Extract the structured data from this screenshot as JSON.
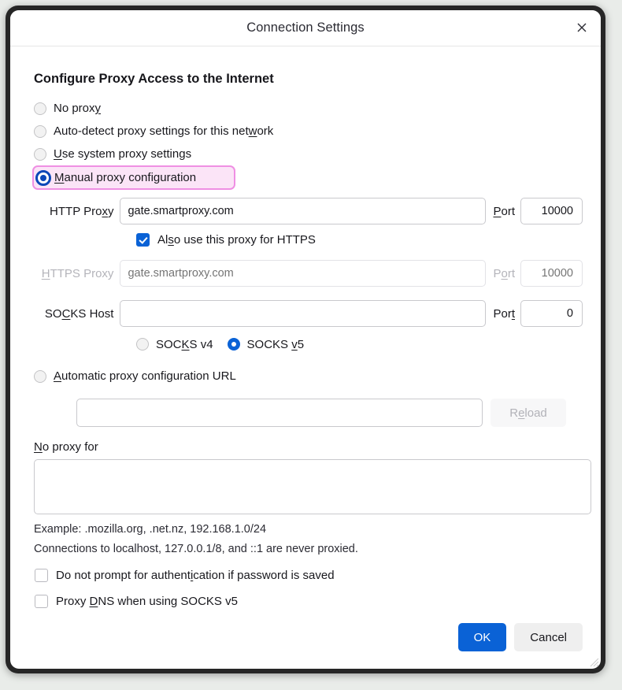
{
  "window": {
    "title": "Connection Settings",
    "close_icon": "close-icon"
  },
  "heading": "Configure Proxy Access to the Internet",
  "proxy_mode": {
    "selected": "manual",
    "options": [
      {
        "id": "none",
        "label": "No proxy",
        "accel": "y",
        "selected": false
      },
      {
        "id": "auto",
        "label": "Auto-detect proxy settings for this network",
        "accel": "w",
        "selected": false
      },
      {
        "id": "system",
        "label": "Use system proxy settings",
        "accel": "U",
        "selected": false
      },
      {
        "id": "manual",
        "label": "Manual proxy configuration",
        "accel": "M",
        "selected": true,
        "highlighted": true
      }
    ]
  },
  "manual": {
    "http": {
      "label": "HTTP Proxy",
      "label_accel": "x",
      "value": "gate.smartproxy.com",
      "placeholder": "",
      "port_label": "Port",
      "port_accel": "P",
      "port_value": "10000",
      "disabled": false
    },
    "also_https": {
      "label": "Also use this proxy for HTTPS",
      "accel": "s",
      "checked": true
    },
    "https": {
      "label": "HTTPS Proxy",
      "label_accel": "H",
      "value": "",
      "placeholder": "gate.smartproxy.com",
      "port_label": "Port",
      "port_accel": "o",
      "port_value": "",
      "port_placeholder": "10000",
      "disabled": true
    },
    "socks": {
      "label": "SOCKS Host",
      "label_accel": "C",
      "value": "",
      "placeholder": "",
      "port_label": "Port",
      "port_accel": "t",
      "port_value": "0",
      "disabled": false,
      "versions": [
        {
          "id": "v4",
          "label": "SOCKS v4",
          "accel": "K",
          "selected": false
        },
        {
          "id": "v5",
          "label": "SOCKS v5",
          "accel": "v",
          "selected": true
        }
      ]
    }
  },
  "pac": {
    "label": "Automatic proxy configuration URL",
    "accel": "A",
    "selected": false,
    "url_value": "",
    "url_placeholder": "",
    "reload_label": "Reload",
    "reload_accel": "e",
    "reload_disabled": true
  },
  "no_proxy": {
    "label": "No proxy for",
    "accel": "N",
    "value": "",
    "placeholder": ""
  },
  "hints": [
    "Example: .mozilla.org, .net.nz, 192.168.1.0/24",
    "Connections to localhost, 127.0.0.1/8, and ::1 are never proxied."
  ],
  "bottom_checks": [
    {
      "id": "no-auth-prompt",
      "label": "Do not prompt for authentication if password is saved",
      "accel": "i",
      "checked": false
    },
    {
      "id": "proxy-dns",
      "label": "Proxy DNS when using SOCKS v5",
      "accel": "D",
      "checked": false
    }
  ],
  "footer": {
    "ok_label": "OK",
    "cancel_label": "Cancel"
  },
  "colors": {
    "accent": "#0a62d6",
    "highlight_fill": "#fbe4f7",
    "highlight_border": "#ef8fe3",
    "frame": "#262626"
  }
}
